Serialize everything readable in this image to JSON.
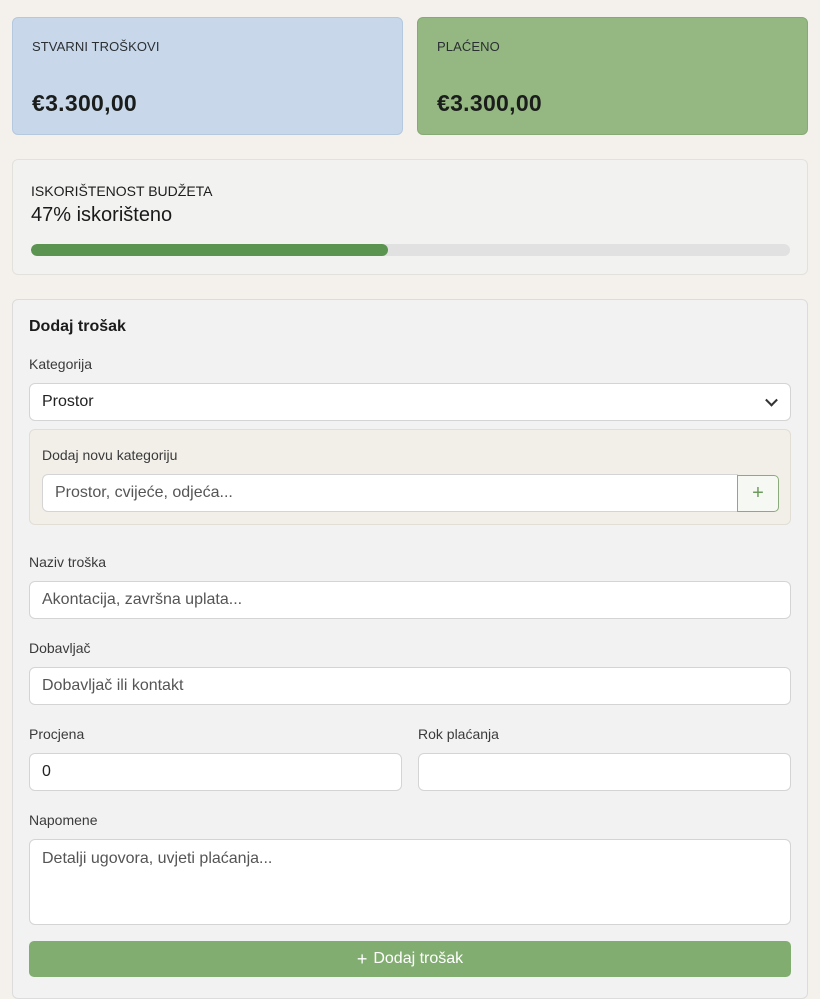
{
  "stats": {
    "actual": {
      "label": "STVARNI TROŠKOVI",
      "value": "€3.300,00"
    },
    "paid": {
      "label": "PLAĆENO",
      "value": "€3.300,00"
    }
  },
  "budget": {
    "label": "ISKORIŠTENOST BUDŽETA",
    "percent_text": "47% iskorišteno",
    "progress_fraction": 0.47
  },
  "form": {
    "title": "Dodaj trošak",
    "category": {
      "label": "Kategorija",
      "value": "Prostor"
    },
    "new_category": {
      "label": "Dodaj novu kategoriju",
      "placeholder": "Prostor, cvijeće, odjeća...",
      "add_icon": "plus-icon"
    },
    "expense_name": {
      "label": "Naziv troška",
      "placeholder": "Akontacija, završna uplata..."
    },
    "vendor": {
      "label": "Dobavljač",
      "placeholder": "Dobavljač ili kontakt"
    },
    "estimate": {
      "label": "Procjena",
      "value": "0"
    },
    "due_date": {
      "label": "Rok plaćanja",
      "value": ""
    },
    "notes": {
      "label": "Napomene",
      "placeholder": "Detalji ugovora, uvjeti plaćanja..."
    },
    "submit_label": "Dodaj trošak"
  },
  "colors": {
    "accent_green": "#82ad71",
    "progress_green": "#5b9451",
    "card_blue": "#c8d8ea",
    "card_green": "#95b882"
  }
}
